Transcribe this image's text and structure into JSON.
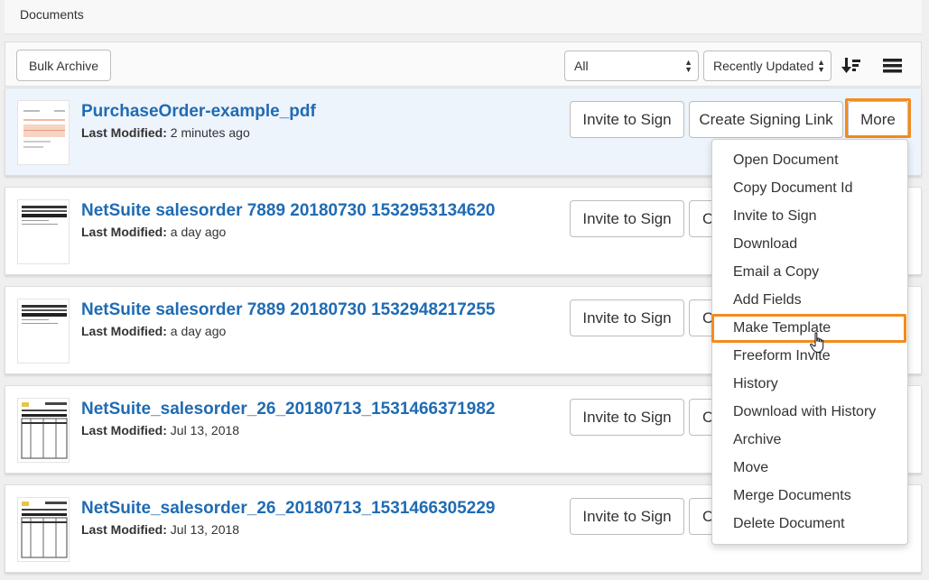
{
  "header": {
    "title": "Documents"
  },
  "toolbar": {
    "bulk_archive": "Bulk Archive",
    "filter_value": "All",
    "sort_value": "Recently Updated"
  },
  "meta_label": "Last Modified:",
  "buttons": {
    "invite": "Invite to Sign",
    "create_link": "Create Signing Link",
    "more": "More",
    "truncated": "C"
  },
  "documents": [
    {
      "title": "PurchaseOrder-example_pdf",
      "modified": "2 minutes ago"
    },
    {
      "title": "NetSuite salesorder 7889 20180730 1532953134620",
      "modified": "a day ago"
    },
    {
      "title": "NetSuite salesorder 7889 20180730 1532948217255",
      "modified": "a day ago"
    },
    {
      "title": "NetSuite_salesorder_26_20180713_1531466371982",
      "modified": "Jul 13, 2018"
    },
    {
      "title": "NetSuite_salesorder_26_20180713_1531466305229",
      "modified": "Jul 13, 2018"
    }
  ],
  "menu": [
    "Open Document",
    "Copy Document Id",
    "Invite to Sign",
    "Download",
    "Email a Copy",
    "Add Fields",
    "Make Template",
    "Freeform Invite",
    "History",
    "Download with History",
    "Archive",
    "Move",
    "Merge Documents",
    "Delete Document"
  ],
  "colors": {
    "accent_link": "#1f6bb3",
    "highlight": "#f28c1e",
    "selected_row": "#eef4fb"
  },
  "icons": {
    "sort": "sort-descending-icon",
    "view": "list-view-icon",
    "cursor": "hand-pointer-icon"
  }
}
